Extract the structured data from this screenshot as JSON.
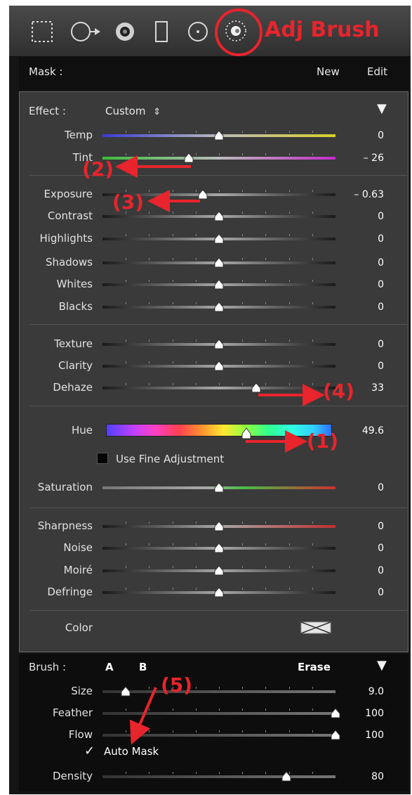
{
  "toolbar": {
    "tools": [
      "marquee-icon",
      "graduated-circle-icon",
      "spot-heal-icon",
      "red-eye-icon",
      "radial-filter-icon",
      "adjustment-brush-icon"
    ],
    "annotation": "Adj Brush"
  },
  "mask": {
    "label": "Mask :",
    "new_label": "New",
    "edit_label": "Edit"
  },
  "effect": {
    "label": "Effect :",
    "preset": "Custom",
    "preset_arrow": "⇕",
    "collapse": "▼"
  },
  "sliders": [
    {
      "label": "Temp",
      "value": "0",
      "pos": 0.5,
      "track": "#d7d027"
    },
    {
      "label": "Tint",
      "value": "– 26",
      "pos": 0.37,
      "track": "#c32ec8"
    },
    {
      "label": "Exposure",
      "value": "– 0.63",
      "pos": 0.43,
      "track": "#777"
    },
    {
      "label": "Contrast",
      "value": "0",
      "pos": 0.5,
      "track": "#777"
    },
    {
      "label": "Highlights",
      "value": "0",
      "pos": 0.5,
      "track": "#777"
    },
    {
      "label": "Shadows",
      "value": "0",
      "pos": 0.5,
      "track": "#777"
    },
    {
      "label": "Whites",
      "value": "0",
      "pos": 0.5,
      "track": "#777"
    },
    {
      "label": "Blacks",
      "value": "0",
      "pos": 0.5,
      "track": "#777"
    },
    {
      "label": "Texture",
      "value": "0",
      "pos": 0.5,
      "track": "#777"
    },
    {
      "label": "Clarity",
      "value": "0",
      "pos": 0.5,
      "track": "#777"
    },
    {
      "label": "Dehaze",
      "value": "33",
      "pos": 0.66,
      "track": "#777"
    }
  ],
  "hue": {
    "label": "Hue",
    "value": "49.6",
    "pos": 0.62,
    "fine_adjust": "Use Fine Adjustment"
  },
  "saturation": {
    "label": "Saturation",
    "value": "0",
    "pos": 0.5
  },
  "detail": [
    {
      "label": "Sharpness",
      "value": "0",
      "pos": 0.5
    },
    {
      "label": "Noise",
      "value": "0",
      "pos": 0.5
    },
    {
      "label": "Moiré",
      "value": "0",
      "pos": 0.5
    },
    {
      "label": "Defringe",
      "value": "0",
      "pos": 0.5
    }
  ],
  "color": {
    "label": "Color"
  },
  "brush": {
    "label": "Brush :",
    "a": "A",
    "b": "B",
    "erase": "Erase",
    "collapse": "▼",
    "sliders": [
      {
        "label": "Size",
        "value": "9.0",
        "pos": 0.1
      },
      {
        "label": "Feather",
        "value": "100",
        "pos": 1.0
      },
      {
        "label": "Flow",
        "value": "100",
        "pos": 1.0
      }
    ],
    "auto_mask": "Auto Mask",
    "density": {
      "label": "Density",
      "value": "80",
      "pos": 0.79
    }
  },
  "annotations": [
    "(1)",
    "(2)",
    "(3)",
    "(4)",
    "(5)"
  ],
  "colors": {
    "annotation_red": "#e8242c"
  }
}
